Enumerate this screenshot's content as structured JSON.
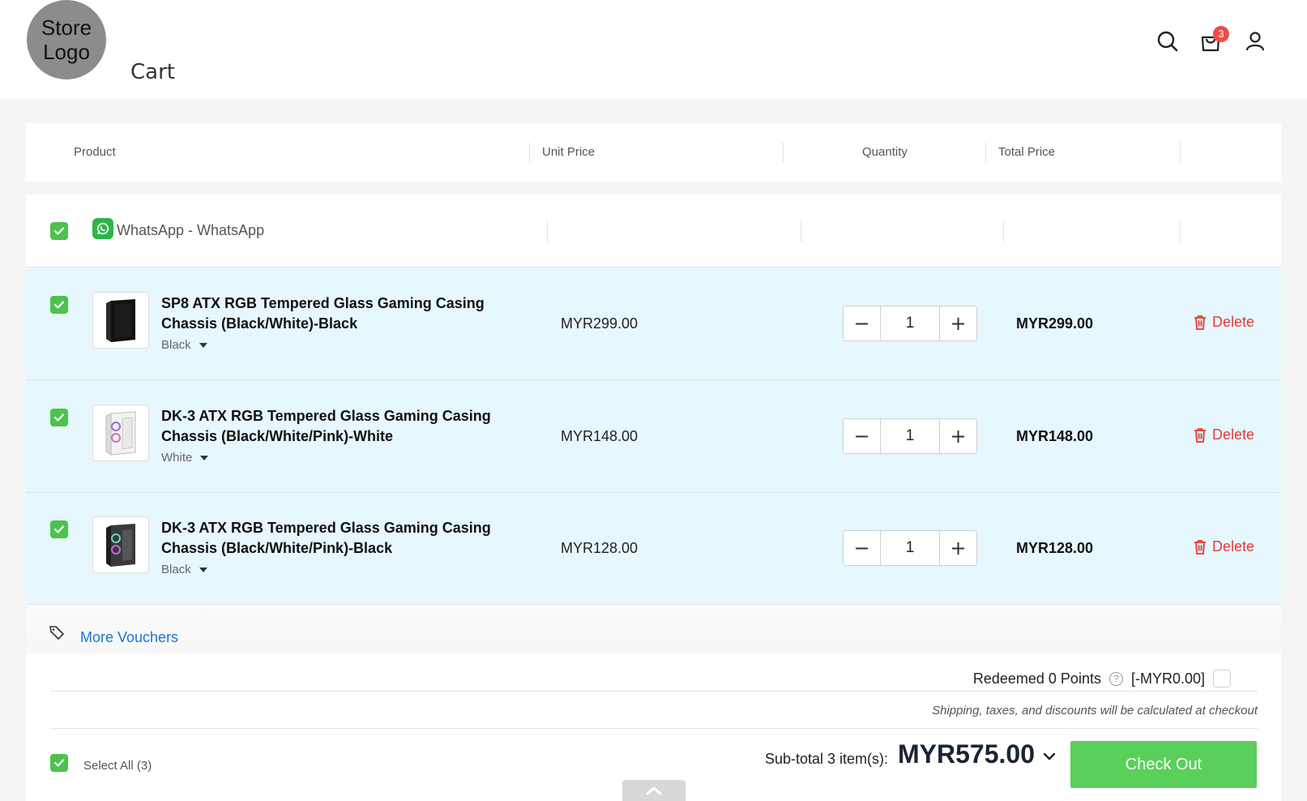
{
  "header": {
    "logo_line1": "Store",
    "logo_line2": "Logo",
    "title": "Cart",
    "cart_count": "3"
  },
  "columns": {
    "product": "Product",
    "unit_price": "Unit Price",
    "quantity": "Quantity",
    "total_price": "Total Price"
  },
  "store": {
    "name": "WhatsApp - WhatsApp",
    "icon": "whatsapp-icon"
  },
  "items": [
    {
      "name": "SP8 ATX RGB Tempered Glass Gaming Casing Chassis (Black/White)-Black",
      "variant": "Black",
      "unit_price": "MYR299.00",
      "quantity": "1",
      "total_price": "MYR299.00",
      "delete_label": "Delete"
    },
    {
      "name": "DK-3 ATX RGB Tempered Glass Gaming Casing Chassis (Black/White/Pink)-White",
      "variant": "White",
      "unit_price": "MYR148.00",
      "quantity": "1",
      "total_price": "MYR148.00",
      "delete_label": "Delete"
    },
    {
      "name": "DK-3 ATX RGB Tempered Glass Gaming Casing Chassis (Black/White/Pink)-Black",
      "variant": "Black",
      "unit_price": "MYR128.00",
      "quantity": "1",
      "total_price": "MYR128.00",
      "delete_label": "Delete"
    }
  ],
  "vouchers": {
    "label": "More Vouchers"
  },
  "summary": {
    "points_label": "Redeemed 0 Points",
    "help_glyph": "?",
    "points_value": "[-MYR0.00]",
    "shipping_note": "Shipping, taxes, and discounts will be calculated at checkout",
    "select_all": "Select All (3)",
    "subtotal_label": "Sub-total 3 item(s):",
    "subtotal_amount": "MYR575.00",
    "checkout_label": "Check Out"
  },
  "colors": {
    "accent_green": "#5acf5a",
    "checkbox_green": "#4cc24c",
    "row_highlight": "#e6f7fd",
    "delete_red": "#e53935",
    "link_blue": "#1976d2",
    "badge_red": "#f04a4a"
  }
}
